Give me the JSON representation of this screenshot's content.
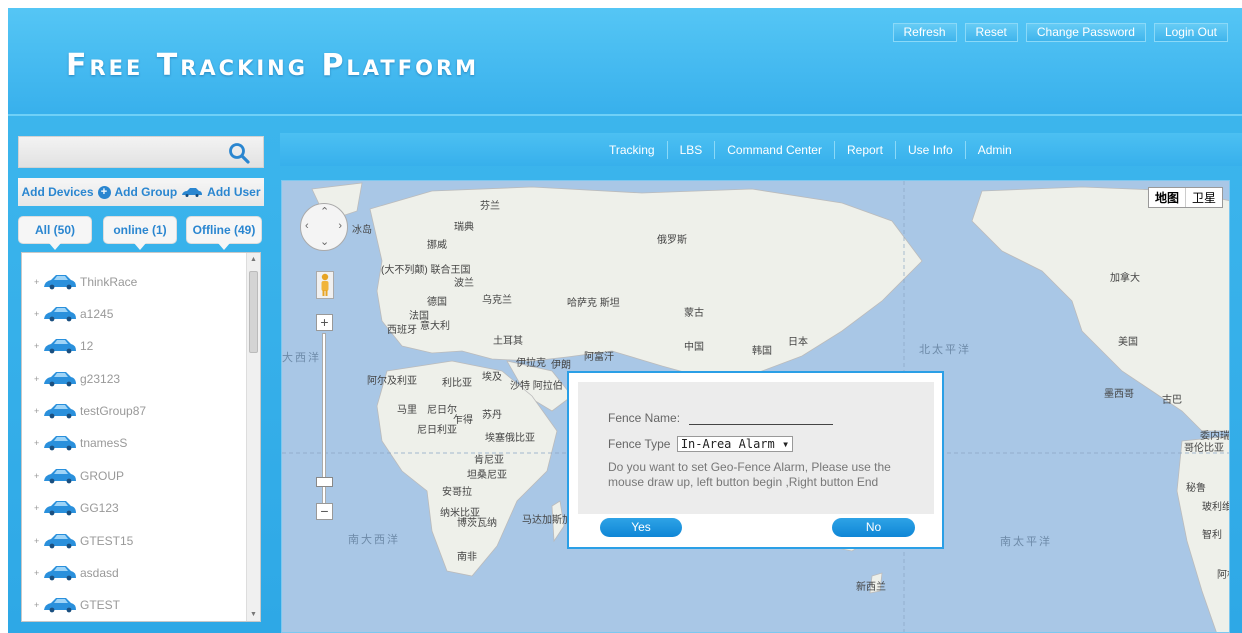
{
  "header": {
    "title": "Free Tracking Platform",
    "buttons": [
      "Refresh",
      "Reset",
      "Change Password",
      "Login Out"
    ]
  },
  "sidebar": {
    "search_placeholder": "",
    "actions": {
      "add_devices": "Add Devices",
      "add_group": "Add Group",
      "add_user": "Add User"
    },
    "filters": {
      "all": "All (50)",
      "online": "online (1)",
      "offline": "Offline (49)"
    },
    "devices": [
      "ThinkRace",
      "a1245",
      "12",
      "g23123",
      "testGroup87",
      "tnamesS",
      "GROUP",
      "GG123",
      "GTEST15",
      "asdasd",
      "GTEST"
    ]
  },
  "nav": {
    "items": [
      "Tracking",
      "LBS",
      "Command Center",
      "Report",
      "Use Info",
      "Admin"
    ]
  },
  "map": {
    "type_buttons": {
      "map": "地图",
      "satellite": "卫星"
    },
    "labels": {
      "finland": "芬兰",
      "iceland": "冰岛",
      "sweden": "瑞典",
      "norway": "挪威",
      "russia": "俄罗斯",
      "uk": "(大不列颠)\n联合王国",
      "poland": "波兰",
      "germany": "德国",
      "ukraine": "乌克兰",
      "france": "法国",
      "italy": "意大利",
      "spain": "西班牙",
      "kazakhstan": "哈萨克\n斯坦",
      "mongolia": "蒙古",
      "turkey": "土耳其",
      "iraq": "伊拉克",
      "iran": "伊朗",
      "afghanistan": "阿富汗",
      "china": "中国",
      "korea": "韩国",
      "japan": "日本",
      "algeria": "阿尔及利亚",
      "libya": "利比亚",
      "egypt": "埃及",
      "saudi": "沙特\n阿拉伯",
      "mali": "马里",
      "niger": "尼日尔",
      "chad": "乍得",
      "sudan": "苏丹",
      "nigeria": "尼日利亚",
      "ethiopia": "埃塞俄比亚",
      "kenya": "肯尼亚",
      "tanzania": "坦桑尼亚",
      "angola": "安哥拉",
      "namibia": "纳米比亚",
      "botswana": "博茨瓦纳",
      "madagascar": "马达加斯加",
      "south_africa": "南非",
      "canada": "加拿大",
      "usa": "美国",
      "mexico": "墨西哥",
      "cuba": "古巴",
      "venezuela": "委内瑞拉",
      "colombia": "哥伦比亚",
      "peru": "秘鲁",
      "bolivia": "玻利维",
      "chile": "智利",
      "argentina": "阿根",
      "new_zealand": "新西兰",
      "north_pacific": "北太平洋",
      "south_pacific": "南太平洋",
      "south_atlantic": "南大西洋",
      "atlantic": "大西洋"
    },
    "colors": {
      "water": "#a9c7e6",
      "land": "#eef0ea",
      "border": "#aaaaaa"
    }
  },
  "dialog": {
    "fence_name_label": "Fence Name:",
    "fence_type_label": "Fence Type",
    "fence_type_value": "In-Area Alarm",
    "message": "Do you want to set Geo-Fence Alarm, Please use the mouse draw up, left button begin ,Right button End",
    "yes": "Yes",
    "no": "No"
  }
}
